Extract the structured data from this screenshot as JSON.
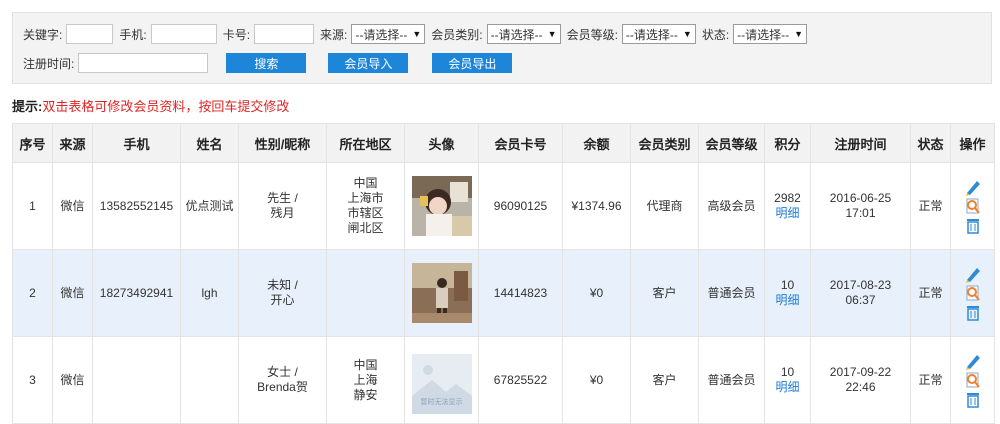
{
  "filters": {
    "keyword_label": "关键字:",
    "phone_label": "手机:",
    "card_label": "卡号:",
    "source_label": "来源:",
    "source_value": "--请选择--",
    "type_label": "会员类别:",
    "type_value": "--请选择--",
    "level_label": "会员等级:",
    "level_value": "--请选择--",
    "status_label": "状态:",
    "status_value": "--请选择--",
    "regtime_label": "注册时间:",
    "search_button": "搜索",
    "import_button": "会员导入",
    "export_button": "会员导出"
  },
  "tip": {
    "label": "提示:",
    "text": "双击表格可修改会员资料，按回车提交修改"
  },
  "table": {
    "headers": [
      "序号",
      "来源",
      "手机",
      "姓名",
      "性别/昵称",
      "所在地区",
      "头像",
      "会员卡号",
      "余额",
      "会员类别",
      "会员等级",
      "积分",
      "注册时间",
      "状态",
      "操作"
    ],
    "detail_link": "明细",
    "rows": [
      {
        "seq": "1",
        "source": "微信",
        "phone": "13582552145",
        "name": "优点测试",
        "gender": "先生 /",
        "nickname": "残月",
        "region": [
          "中国",
          "上海市",
          "市辖区",
          "闸北区"
        ],
        "avatar": "photo",
        "card": "96090125",
        "balance": "¥1374.96",
        "type": "代理商",
        "level": "高级会员",
        "points": "2982",
        "reg_date": "2016-06-25",
        "reg_time": "17:01",
        "status": "正常"
      },
      {
        "seq": "2",
        "source": "微信",
        "phone": "18273492941",
        "name": "lgh",
        "gender": "未知 /",
        "nickname": "开心",
        "region": [
          "",
          "",
          "",
          ""
        ],
        "avatar": "photo",
        "card": "14414823",
        "balance": "¥0",
        "type": "客户",
        "level": "普通会员",
        "points": "10",
        "reg_date": "2017-08-23",
        "reg_time": "06:37",
        "status": "正常"
      },
      {
        "seq": "3",
        "source": "微信",
        "phone": "",
        "name": "",
        "gender": "女士 /",
        "nickname": "Brenda贺",
        "region": [
          "中国",
          "上海",
          "静安",
          ""
        ],
        "avatar": "placeholder",
        "avatar_caption": "暂时无法显示",
        "card": "67825522",
        "balance": "¥0",
        "type": "客户",
        "level": "普通会员",
        "points": "10",
        "reg_date": "2017-09-22",
        "reg_time": "22:46",
        "status": "正常"
      }
    ]
  },
  "colors": {
    "button": "#1e86d8",
    "tip_red": "#e02424",
    "link": "#1e7bd4",
    "row_highlight": "#e8f1fb"
  },
  "icons": [
    "edit-pencil-icon",
    "view-detail-icon",
    "delete-trash-icon",
    "chevron-down-icon"
  ]
}
